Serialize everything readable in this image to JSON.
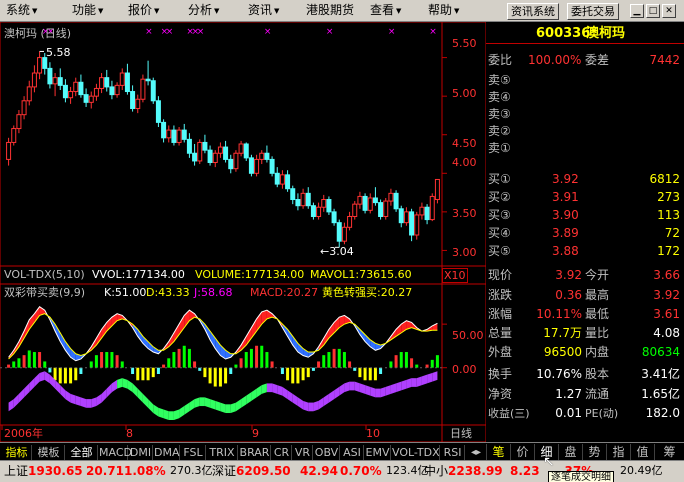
{
  "colors": {
    "up": "#ff3232",
    "down": "#54fcfc",
    "axis": "#c00000",
    "label": "#c0c0c0",
    "yellow": "#ffff00",
    "magenta": "#ff00ff",
    "green": "#00ff00",
    "white": "#ffffff"
  },
  "menu": [
    {
      "label": "系统"
    },
    {
      "label": "功能"
    },
    {
      "label": "报价"
    },
    {
      "label": "分析"
    },
    {
      "label": "资讯"
    },
    {
      "label": "港股期货"
    },
    {
      "label": "查看"
    },
    {
      "label": "帮助"
    }
  ],
  "top_buttons": {
    "info": "资讯系统",
    "trade": "委托交易"
  },
  "chart": {
    "title": "澳柯玛 (日线)",
    "high_mark": "5.58",
    "low_mark": "←3.04",
    "price_ticks": [
      "5.50",
      "5.00",
      "4.50",
      "4.00",
      "3.50",
      "3.00"
    ],
    "vol_header": {
      "name": "VOL-TDX(5,10)",
      "vvol": "VVOL:177134.00",
      "volume": "VOLUME:177134.00",
      "mavol": "MAVOL1:73615.60",
      "scale": "X10"
    },
    "macd_header": {
      "name": "双彩带买卖(9,9)",
      "k": "K:51.00",
      "d": "D:43.33",
      "j": "J:58.68",
      "macd": "MACD:20.27",
      "signal": "黄色转强买:20.27"
    },
    "macd_ticks": [
      "50.00",
      "0.00"
    ],
    "date_labels": [
      "2006年",
      "8",
      "9",
      "10"
    ],
    "period": "日线"
  },
  "quote": {
    "code": "600336",
    "name": "澳柯玛",
    "ratio_label": "委比",
    "ratio_value": "100.00%",
    "diff_label": "委差",
    "diff_value": "7442",
    "asks": [
      {
        "label": "卖⑤",
        "price": "",
        "vol": ""
      },
      {
        "label": "卖④",
        "price": "",
        "vol": ""
      },
      {
        "label": "卖③",
        "price": "",
        "vol": ""
      },
      {
        "label": "卖②",
        "price": "",
        "vol": ""
      },
      {
        "label": "卖①",
        "price": "",
        "vol": ""
      }
    ],
    "bids": [
      {
        "label": "买①",
        "price": "3.92",
        "vol": "6812"
      },
      {
        "label": "买②",
        "price": "3.91",
        "vol": "273"
      },
      {
        "label": "买③",
        "price": "3.90",
        "vol": "113"
      },
      {
        "label": "买④",
        "price": "3.89",
        "vol": "72"
      },
      {
        "label": "买⑤",
        "price": "3.88",
        "vol": "172"
      }
    ],
    "stats1": [
      {
        "l1": "现价",
        "v1": "3.92",
        "l2": "今开",
        "v2": "3.66"
      },
      {
        "l1": "涨跌",
        "v1": "0.36",
        "l2": "最高",
        "v2": "3.92"
      },
      {
        "l1": "涨幅",
        "v1": "10.11%",
        "l2": "最低",
        "v2": "3.61"
      },
      {
        "l1": "总量",
        "v1": "17.7万",
        "l2": "量比",
        "v2": "4.08"
      },
      {
        "l1": "外盘",
        "v1": "96500",
        "l2": "内盘",
        "v2": "80634"
      }
    ],
    "stats2": [
      {
        "l1": "换手",
        "v1": "10.76%",
        "l2": "股本",
        "v2": "3.41亿"
      },
      {
        "l1": "净资",
        "v1": "1.27",
        "l2": "流通",
        "v2": "1.65亿"
      },
      {
        "l1": "收益(三)",
        "v1": "0.01",
        "l2": "PE(动)",
        "v2": "182.0"
      }
    ]
  },
  "indicator_tabs": [
    "指标",
    "模板",
    "全部",
    "MACD",
    "DMI",
    "DMA",
    "FSL",
    "TRIX",
    "BRAR",
    "CR",
    "VR",
    "OBV",
    "ASI",
    "EMV",
    "VOL-TDX",
    "RSI"
  ],
  "panel_tabs": [
    "笔",
    "价",
    "细",
    "盘",
    "势",
    "指",
    "值",
    "筹"
  ],
  "status": {
    "sh_label": "上证",
    "sh_index": "1930.65",
    "sh_change": "20.71",
    "sh_pct": "1.08%",
    "sh_amount": "270.3亿",
    "sz_label": "深证",
    "sz_index": "6209.50",
    "sz_change": "42.94",
    "sz_pct": "0.70%",
    "sz_amount": "123.4亿",
    "sme_label": "中小",
    "sme_index": "2238.99",
    "sme_change": "8.23",
    "sme_pct": ".37%",
    "sme_amount": "20.49亿",
    "tooltip": "逐笔成交明细"
  },
  "chart_data": [
    {
      "type": "candlestick",
      "title": "澳柯玛 (日线)",
      "ylim": [
        2.85,
        5.78
      ],
      "y_ticks": [
        5.5,
        5.0,
        4.5,
        4.0,
        3.5,
        3.0
      ],
      "max_marker": 5.58,
      "min_marker": 3.04,
      "x_labels": [
        "2006年",
        "8",
        "9",
        "10"
      ],
      "ohlc": [
        [
          4.18,
          4.46,
          4.1,
          4.4
        ],
        [
          4.4,
          4.62,
          4.36,
          4.58
        ],
        [
          4.58,
          4.82,
          4.52,
          4.76
        ],
        [
          4.76,
          5.0,
          4.7,
          4.94
        ],
        [
          4.94,
          5.2,
          4.88,
          5.12
        ],
        [
          5.12,
          5.4,
          5.05,
          5.3
        ],
        [
          5.3,
          5.58,
          5.22,
          5.5
        ],
        [
          5.5,
          5.56,
          5.28,
          5.36
        ],
        [
          5.36,
          5.44,
          5.1,
          5.16
        ],
        [
          5.16,
          5.3,
          5.0,
          5.24
        ],
        [
          5.24,
          5.36,
          5.08,
          5.14
        ],
        [
          5.14,
          5.22,
          4.92,
          4.98
        ],
        [
          4.98,
          5.12,
          4.9,
          5.06
        ],
        [
          5.06,
          5.24,
          5.0,
          5.18
        ],
        [
          5.18,
          5.28,
          4.98,
          5.02
        ],
        [
          5.02,
          5.1,
          4.86,
          4.92
        ],
        [
          4.92,
          5.06,
          4.84,
          5.0
        ],
        [
          5.0,
          5.16,
          4.94,
          5.1
        ],
        [
          5.1,
          5.3,
          5.04,
          5.24
        ],
        [
          5.24,
          5.34,
          5.06,
          5.12
        ],
        [
          5.12,
          5.2,
          4.96,
          5.02
        ],
        [
          5.02,
          5.18,
          4.98,
          5.14
        ],
        [
          5.14,
          5.36,
          5.08,
          5.3
        ],
        [
          5.3,
          5.42,
          5.02,
          5.06
        ],
        [
          5.06,
          5.14,
          4.8,
          4.84
        ],
        [
          4.84,
          5.02,
          4.78,
          4.96
        ],
        [
          4.96,
          5.28,
          4.92,
          5.22
        ],
        [
          5.22,
          5.46,
          5.14,
          5.2
        ],
        [
          5.2,
          5.24,
          4.9,
          4.94
        ],
        [
          4.94,
          5.0,
          4.6,
          4.66
        ],
        [
          4.66,
          4.7,
          4.4,
          4.46
        ],
        [
          4.46,
          4.62,
          4.4,
          4.56
        ],
        [
          4.56,
          4.62,
          4.36,
          4.4
        ],
        [
          4.4,
          4.6,
          4.36,
          4.56
        ],
        [
          4.56,
          4.64,
          4.4,
          4.44
        ],
        [
          4.44,
          4.52,
          4.2,
          4.26
        ],
        [
          4.26,
          4.38,
          4.1,
          4.16
        ],
        [
          4.16,
          4.44,
          4.12,
          4.4
        ],
        [
          4.4,
          4.5,
          4.26,
          4.3
        ],
        [
          4.3,
          4.36,
          4.1,
          4.14
        ],
        [
          4.14,
          4.3,
          4.08,
          4.26
        ],
        [
          4.26,
          4.4,
          4.2,
          4.34
        ],
        [
          4.34,
          4.42,
          4.14,
          4.18
        ],
        [
          4.18,
          4.24,
          4.0,
          4.06
        ],
        [
          4.06,
          4.3,
          4.02,
          4.26
        ],
        [
          4.26,
          4.42,
          4.22,
          4.38
        ],
        [
          4.38,
          4.4,
          4.16,
          4.2
        ],
        [
          4.2,
          4.24,
          3.96,
          4.0
        ],
        [
          4.0,
          4.24,
          3.96,
          4.18
        ],
        [
          4.18,
          4.3,
          4.12,
          4.26
        ],
        [
          4.26,
          4.36,
          4.14,
          4.18
        ],
        [
          4.18,
          4.22,
          3.96,
          4.0
        ],
        [
          4.0,
          4.08,
          3.82,
          3.86
        ],
        [
          3.86,
          4.04,
          3.8,
          3.98
        ],
        [
          3.98,
          4.04,
          3.76,
          3.8
        ],
        [
          3.8,
          3.84,
          3.6,
          3.66
        ],
        [
          3.66,
          3.74,
          3.52,
          3.58
        ],
        [
          3.58,
          3.8,
          3.54,
          3.74
        ],
        [
          3.74,
          3.82,
          3.54,
          3.58
        ],
        [
          3.58,
          3.62,
          3.4,
          3.44
        ],
        [
          3.44,
          3.62,
          3.4,
          3.56
        ],
        [
          3.56,
          3.72,
          3.5,
          3.66
        ],
        [
          3.66,
          3.7,
          3.46,
          3.5
        ],
        [
          3.5,
          3.54,
          3.32,
          3.36
        ],
        [
          3.36,
          3.4,
          3.04,
          3.12
        ],
        [
          3.12,
          3.36,
          3.08,
          3.3
        ],
        [
          3.3,
          3.5,
          3.26,
          3.44
        ],
        [
          3.44,
          3.64,
          3.4,
          3.6
        ],
        [
          3.6,
          3.76,
          3.54,
          3.7
        ],
        [
          3.7,
          3.74,
          3.48,
          3.52
        ],
        [
          3.52,
          3.74,
          3.48,
          3.68
        ],
        [
          3.68,
          3.82,
          3.58,
          3.62
        ],
        [
          3.62,
          3.66,
          3.4,
          3.44
        ],
        [
          3.44,
          3.68,
          3.4,
          3.64
        ],
        [
          3.64,
          3.8,
          3.58,
          3.74
        ],
        [
          3.74,
          3.78,
          3.5,
          3.54
        ],
        [
          3.54,
          3.58,
          3.3,
          3.36
        ],
        [
          3.36,
          3.56,
          3.32,
          3.5
        ],
        [
          3.5,
          3.54,
          3.12,
          3.2
        ],
        [
          3.2,
          3.5,
          3.14,
          3.46
        ],
        [
          3.46,
          3.62,
          3.4,
          3.56
        ],
        [
          3.56,
          3.6,
          3.34,
          3.4
        ],
        [
          3.4,
          3.74,
          3.38,
          3.7
        ],
        [
          3.66,
          3.92,
          3.61,
          3.92
        ]
      ]
    },
    {
      "type": "area",
      "title": "双彩带买卖(9,9)",
      "ylim": [
        -60,
        80
      ],
      "y_ticks": [
        50,
        0
      ],
      "series": [
        {
          "name": "K",
          "values": [
            12,
            20,
            30,
            42,
            55,
            62,
            70,
            66,
            55,
            42,
            30,
            20,
            12,
            8,
            10,
            16,
            24,
            34,
            44,
            52,
            58,
            62,
            60,
            54,
            46,
            36,
            28,
            22,
            18,
            16,
            22,
            30,
            40,
            50,
            60,
            66,
            62,
            54,
            44,
            32,
            22,
            14,
            10,
            12,
            18,
            26,
            36,
            46,
            56,
            64,
            66,
            62,
            56,
            46,
            36,
            26,
            18,
            14,
            12,
            16,
            24,
            34,
            44,
            52,
            58,
            60,
            56,
            48,
            38,
            30,
            24,
            20,
            22,
            28,
            36,
            44,
            50,
            54,
            52,
            46,
            42,
            44,
            48,
            51
          ]
        },
        {
          "name": "D",
          "values": [
            10,
            16,
            24,
            34,
            44,
            52,
            60,
            62,
            58,
            50,
            40,
            30,
            22,
            16,
            14,
            16,
            20,
            26,
            34,
            42,
            48,
            54,
            56,
            54,
            50,
            44,
            36,
            30,
            24,
            20,
            20,
            24,
            30,
            38,
            46,
            54,
            58,
            56,
            50,
            42,
            34,
            26,
            20,
            16,
            16,
            20,
            26,
            34,
            42,
            50,
            56,
            58,
            56,
            50,
            44,
            36,
            28,
            22,
            18,
            18,
            20,
            26,
            34,
            40,
            46,
            50,
            52,
            50,
            44,
            38,
            32,
            28,
            26,
            28,
            32,
            36,
            40,
            44,
            46,
            44,
            42,
            42,
            43,
            43
          ]
        },
        {
          "name": "MACD",
          "values": [
            -40,
            -36,
            -30,
            -24,
            -18,
            -12,
            -6,
            -4,
            -8,
            -14,
            -20,
            -26,
            -30,
            -32,
            -34,
            -36,
            -36,
            -34,
            -30,
            -24,
            -18,
            -14,
            -12,
            -14,
            -18,
            -24,
            -30,
            -36,
            -42,
            -46,
            -48,
            -50,
            -50,
            -48,
            -44,
            -40,
            -36,
            -34,
            -34,
            -36,
            -38,
            -40,
            -42,
            -42,
            -40,
            -36,
            -32,
            -28,
            -24,
            -20,
            -18,
            -18,
            -20,
            -22,
            -26,
            -30,
            -34,
            -38,
            -40,
            -40,
            -38,
            -34,
            -30,
            -26,
            -22,
            -18,
            -16,
            -16,
            -18,
            -20,
            -22,
            -24,
            -24,
            -22,
            -20,
            -18,
            -16,
            -14,
            -12,
            -12,
            -10,
            -8,
            -6,
            -4
          ]
        }
      ]
    }
  ]
}
